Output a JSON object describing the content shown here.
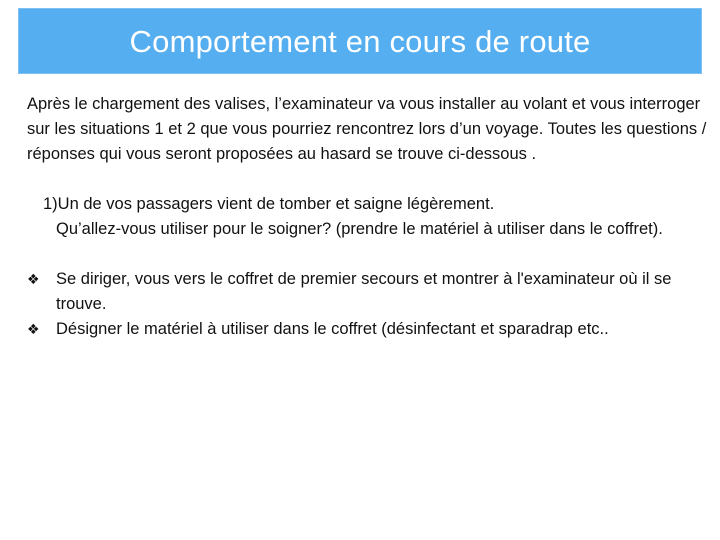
{
  "slide": {
    "title": "Comportement en cours de route",
    "intro": "Après le chargement des valises, l’examinateur va vous installer au volant et vous interroger sur les situations 1 et 2  que vous pourriez rencontrez lors d’un voyage. Toutes les questions / réponses qui vous seront proposées au hasard se trouve ci-dessous .",
    "question": {
      "number": "1)",
      "line1": "Un de vos passagers vient de tomber et saigne légèrement.",
      "line2": "Qu’allez-vous utiliser pour le soigner? (prendre le matériel à utiliser dans le coffret)."
    },
    "bullets": [
      {
        "icon": "diamond-bullet-icon",
        "text": "Se diriger, vous vers le coffret de premier secours et montrer  à l'examinateur où il se trouve."
      },
      {
        "icon": "diamond-bullet-icon",
        "text": "Désigner le matériel à utiliser dans le coffret  (désinfectant et sparadrap etc.."
      }
    ],
    "colors": {
      "title_bar": "#55aef0",
      "title_text": "#ffffff",
      "body_text": "#111111"
    }
  }
}
